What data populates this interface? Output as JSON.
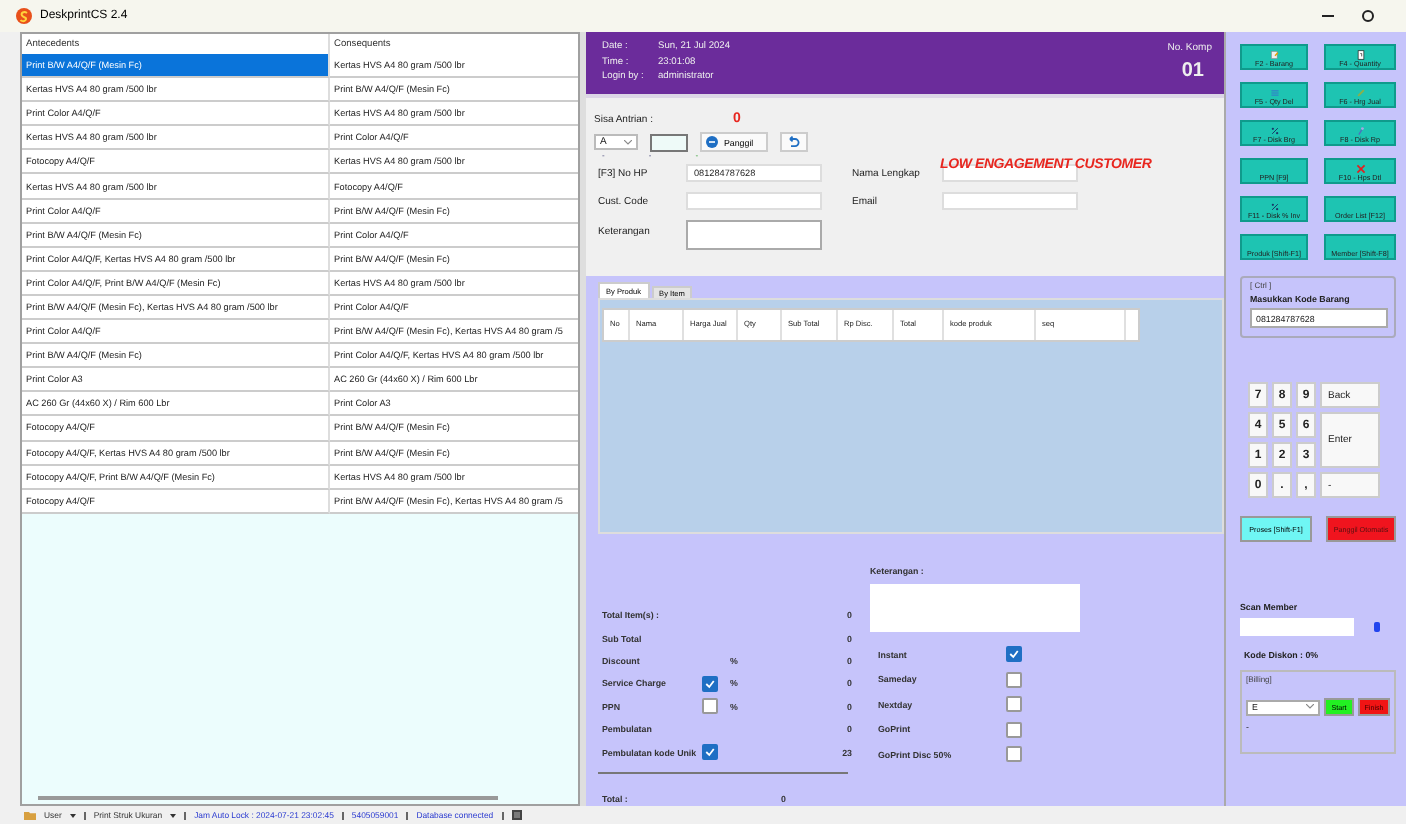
{
  "window": {
    "title": "DeskprintCS 2.4"
  },
  "rules_table": {
    "columns": [
      "Antecedents",
      "Consequents"
    ],
    "rows": [
      {
        "antecedents": "Print B/W A4/Q/F (Mesin Fc)",
        "consequents": "Kertas HVS A4 80 gram /500 lbr",
        "selected": true
      },
      {
        "antecedents": "Kertas HVS A4 80 gram /500 lbr",
        "consequents": "Print B/W A4/Q/F (Mesin Fc)",
        "selected": false
      },
      {
        "antecedents": "Print Color A4/Q/F",
        "consequents": "Kertas HVS A4 80 gram /500 lbr",
        "selected": false
      },
      {
        "antecedents": "Kertas HVS A4 80 gram /500 lbr",
        "consequents": "Print Color A4/Q/F",
        "selected": false
      },
      {
        "antecedents": "Fotocopy A4/Q/F",
        "consequents": "Kertas HVS A4 80 gram /500 lbr",
        "selected": false
      },
      {
        "antecedents": "Kertas HVS A4 80 gram /500 lbr",
        "consequents": "Fotocopy A4/Q/F",
        "selected": false
      },
      {
        "antecedents": "Print Color A4/Q/F",
        "consequents": "Print B/W A4/Q/F (Mesin Fc)",
        "selected": false
      },
      {
        "antecedents": "Print B/W A4/Q/F (Mesin Fc)",
        "consequents": "Print Color A4/Q/F",
        "selected": false
      },
      {
        "antecedents": "Print Color A4/Q/F, Kertas HVS A4 80 gram /500 lbr",
        "consequents": "Print B/W A4/Q/F (Mesin Fc)",
        "selected": false
      },
      {
        "antecedents": "Print Color A4/Q/F, Print B/W A4/Q/F (Mesin Fc)",
        "consequents": "Kertas HVS A4 80 gram /500 lbr",
        "selected": false
      },
      {
        "antecedents": "Print B/W A4/Q/F (Mesin Fc), Kertas HVS A4 80 gram /500 lbr",
        "consequents": "Print Color A4/Q/F",
        "selected": false
      },
      {
        "antecedents": "Print Color A4/Q/F",
        "consequents": "Print B/W A4/Q/F (Mesin Fc), Kertas HVS A4 80 gram /5",
        "selected": false
      },
      {
        "antecedents": "Print B/W A4/Q/F (Mesin Fc)",
        "consequents": "Print Color A4/Q/F, Kertas HVS A4 80 gram /500 lbr",
        "selected": false
      },
      {
        "antecedents": "Print Color A3",
        "consequents": "AC 260 Gr (44x60 X) / Rim 600 Lbr",
        "selected": false
      },
      {
        "antecedents": "AC 260 Gr (44x60 X) / Rim 600 Lbr",
        "consequents": "Print Color A3",
        "selected": false
      },
      {
        "antecedents": "Fotocopy A4/Q/F",
        "consequents": "Print B/W A4/Q/F (Mesin Fc)",
        "selected": false
      },
      {
        "antecedents": "Fotocopy A4/Q/F, Kertas HVS A4 80 gram /500 lbr",
        "consequents": "Print B/W A4/Q/F (Mesin Fc)",
        "selected": false
      },
      {
        "antecedents": "Fotocopy A4/Q/F, Print B/W A4/Q/F (Mesin Fc)",
        "consequents": "Kertas HVS A4 80 gram /500 lbr",
        "selected": false
      },
      {
        "antecedents": "Fotocopy A4/Q/F",
        "consequents": "Print B/W A4/Q/F (Mesin Fc), Kertas HVS A4 80 gram /5",
        "selected": false
      }
    ]
  },
  "header": {
    "info": [
      {
        "label": "Date :",
        "value": "Sun, 21 Jul 2024"
      },
      {
        "label": "Time :",
        "value": "23:01:08"
      },
      {
        "label": "Login by :",
        "value": "administrator"
      }
    ],
    "komp_label": "No. Komp",
    "komp_value": "01"
  },
  "queue": {
    "label": "Sisa Antrian :",
    "count": "0",
    "letter": "A",
    "call_button": "Panggil",
    "marks": [
      "-",
      "-",
      "-"
    ]
  },
  "alert": "LOW ENGAGEMENT CUSTOMER",
  "customer": {
    "phone_label": "[F3] No HP",
    "phone": "081284787628",
    "code_label": "Cust. Code",
    "note_label": "Keterangan",
    "name_label": "Nama Lengkap",
    "email_label": "Email"
  },
  "tabs": [
    {
      "label": "By Produk",
      "selected": true
    },
    {
      "label": "By Item",
      "selected": false
    }
  ],
  "items_table": {
    "columns": [
      "No",
      "Nama",
      "Harga Jual",
      "Qty",
      "Sub Total",
      "Rp Disc.",
      "Total",
      "kode produk",
      "seq"
    ]
  },
  "totals": [
    {
      "label": "Total Item(s) :",
      "value": "0"
    },
    {
      "label": "Sub Total",
      "value": "0"
    },
    {
      "label": "Discount",
      "unit": "%",
      "value": "0"
    },
    {
      "label": "Service Charge",
      "checked": true,
      "unit": "%",
      "value": "0"
    },
    {
      "label": "PPN",
      "checked": false,
      "unit": "%",
      "value": "0"
    },
    {
      "label": "Pembulatan",
      "value": "0"
    },
    {
      "label": "Pembulatan kode Unik",
      "checked": true,
      "value": "23"
    }
  ],
  "grand_total": {
    "label": "Total :",
    "value": "0"
  },
  "note": {
    "label": "Keterangan :"
  },
  "services": [
    {
      "label": "Instant",
      "checked": true
    },
    {
      "label": "Sameday",
      "checked": false
    },
    {
      "label": "Nextday",
      "checked": false
    },
    {
      "label": "GoPrint",
      "checked": false
    },
    {
      "label": "GoPrint Disc 50%",
      "checked": false
    }
  ],
  "function_keys": [
    "F2 - Barang",
    "F4 - Quantity",
    "F5 - Qty Del",
    "F6 - Hrg Jual",
    "F7 - Disk Brg",
    "F8 - Disk Rp",
    "PPN [F9]",
    "F10 - Hps Dtl",
    "F11 - Disk % Inv",
    "Order List [F12]",
    "Produk [Shift-F1]",
    "Member [Shift-F8]"
  ],
  "barcode": {
    "group": "[ Ctrl ]",
    "label": "Masukkan Kode Barang",
    "value": "081284787628"
  },
  "keypad": [
    "7",
    "8",
    "9",
    "Back",
    "4",
    "5",
    "6",
    "Enter",
    "1",
    "2",
    "3",
    "0",
    ".",
    ",",
    "-"
  ],
  "actions": [
    {
      "label": "Proses [Shift-F1]",
      "kind": "process"
    },
    {
      "label": "Panggil Otomatis",
      "kind": "danger"
    }
  ],
  "member": {
    "label": "Scan Member",
    "discount": "Kode Diskon : 0%"
  },
  "billing": {
    "group": "[Billing]",
    "select": "E",
    "start": "Start",
    "finish": "Finish",
    "status": "-"
  },
  "status_bar": {
    "user": "User",
    "print": "Print Struk Ukuran",
    "lock": "Jam Auto Lock : 2024-07-21 23:02:45",
    "code": "5405059001",
    "db": "Database connected"
  }
}
